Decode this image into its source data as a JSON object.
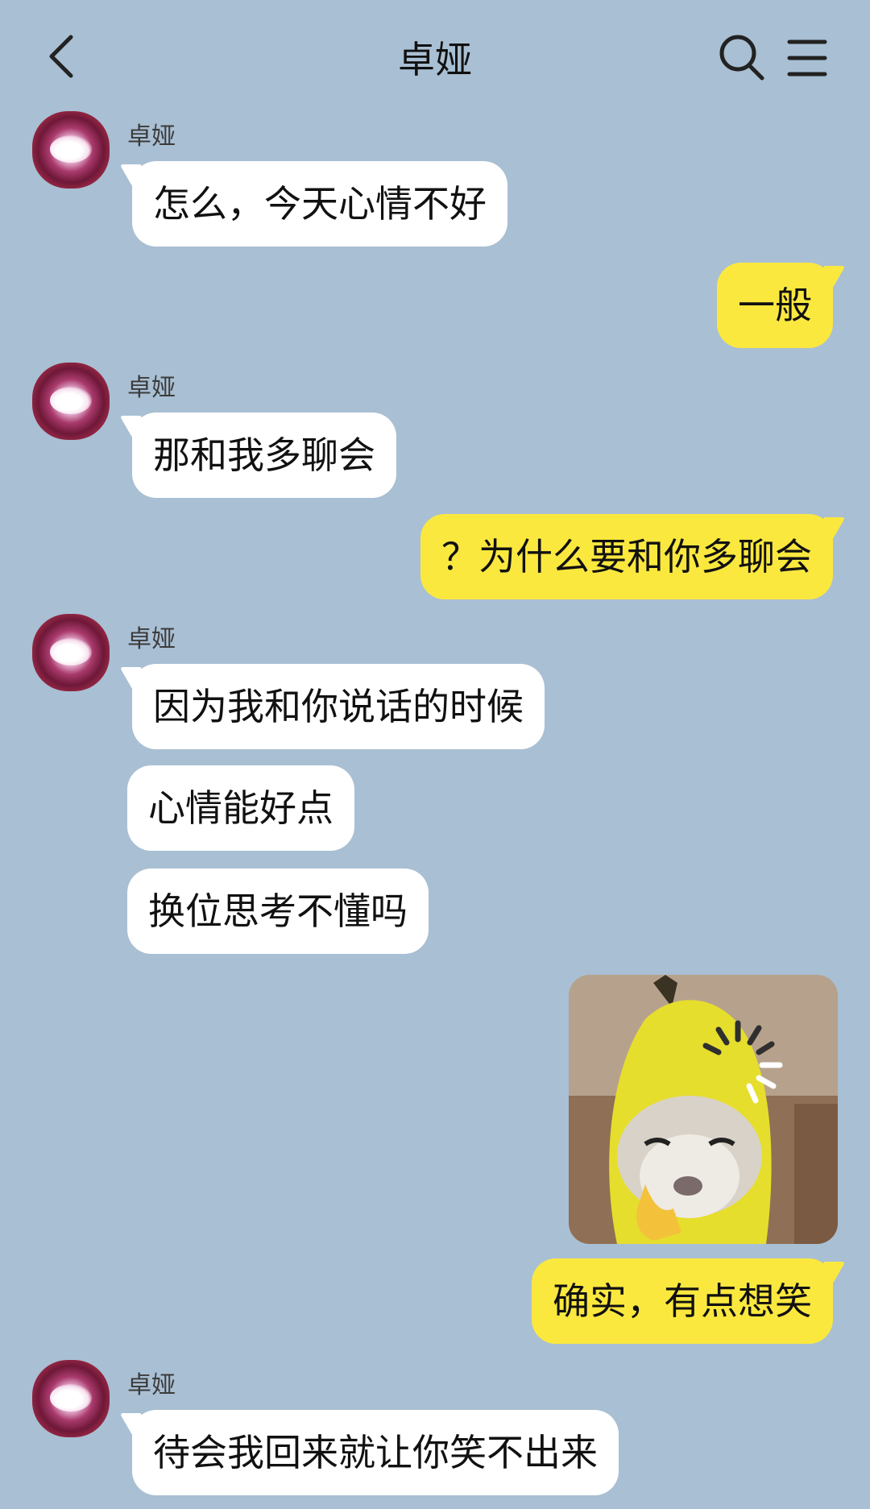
{
  "header": {
    "title": "卓娅",
    "back_icon": "chevron-left-icon",
    "search_icon": "search-icon",
    "menu_icon": "hamburger-menu-icon"
  },
  "colors": {
    "background": "#a9bfd3",
    "incoming_bubble": "#ffffff",
    "outgoing_bubble": "#fbe83f"
  },
  "messages": [
    {
      "from": "other",
      "sender": "卓娅",
      "text": "怎么，今天心情不好"
    },
    {
      "from": "me",
      "text": "一般"
    },
    {
      "from": "other",
      "sender": "卓娅",
      "text": "那和我多聊会"
    },
    {
      "from": "me",
      "text": "？为什么要和你多聊会"
    },
    {
      "from": "other",
      "sender": "卓娅",
      "text": "因为我和你说话的时候"
    },
    {
      "from": "other",
      "text": "心情能好点"
    },
    {
      "from": "other",
      "text": "换位思考不懂吗"
    },
    {
      "from": "me",
      "type": "sticker",
      "sticker": "banana-cat-thumbs-up-sticker"
    },
    {
      "from": "me",
      "text": "确实，有点想笑"
    },
    {
      "from": "other",
      "sender": "卓娅",
      "text": "待会我回来就让你笑不出来"
    }
  ]
}
